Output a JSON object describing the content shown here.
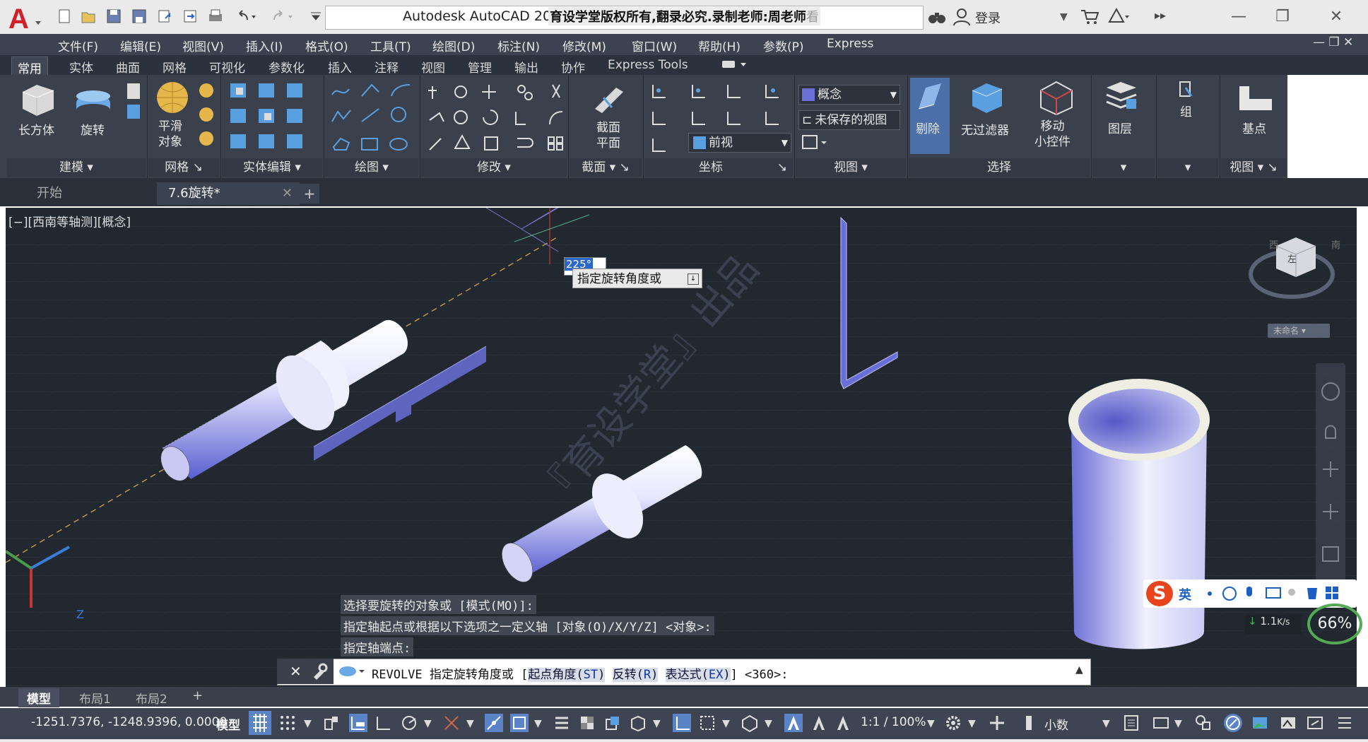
{
  "window": {
    "title": "Autodesk AutoCAD 201",
    "overlay_text": "育设学堂版权所有,翻录必究.录制老师:周老师",
    "overlay_suffix": "看",
    "login": "登录"
  },
  "menu": [
    "文件(F)",
    "编辑(E)",
    "视图(V)",
    "插入(I)",
    "格式(O)",
    "工具(T)",
    "绘图(D)",
    "标注(N)",
    "修改(M)",
    "窗口(W)",
    "帮助(H)",
    "参数(P)",
    "Express"
  ],
  "ribbon_tabs": [
    "常用",
    "实体",
    "曲面",
    "网格",
    "可视化",
    "参数化",
    "插入",
    "注释",
    "视图",
    "管理",
    "输出",
    "协作",
    "Express Tools"
  ],
  "ribbon": {
    "box": "长方体",
    "revolve": "旋转",
    "smooth_line1": "平滑",
    "smooth_line2": "对象",
    "section_line1": "截面",
    "section_line2": "平面",
    "visual_style": "概念",
    "saved_view": "未保存的视图",
    "front_view": "前视",
    "cull": "剔除",
    "no_filter": "无过滤器",
    "gizmo_line1": "移动",
    "gizmo_line2": "小控件",
    "layers": "图层",
    "group": "组",
    "base_point": "基点",
    "panels": [
      "建模",
      "网格",
      "实体编辑",
      "绘图",
      "修改",
      "截面",
      "坐标",
      "视图",
      "选择",
      "视图"
    ]
  },
  "doc_tabs": [
    "开始",
    "7.6旋转*"
  ],
  "viewport": {
    "label": "[−][西南等轴测][概念]",
    "tooltip": "指定旋转角度或",
    "angle_input": "225°",
    "viewcube_label": "未命名",
    "viewcube_face": "左",
    "compass_w": "西",
    "compass_s": "南",
    "ucs_z": "Z",
    "watermark": "『育设学堂』出品"
  },
  "command": {
    "history": [
      "选择要旋转的对象或 [模式(MO)]:",
      "指定轴起点或根据以下选项之一定义轴 [对象(O)/X/Y/Z] <对象>:",
      "指定轴端点:"
    ],
    "prompt_cmd": "REVOLVE 指定旋转角度或 [",
    "opt1_label": "起点角度(",
    "opt1_key": "ST",
    "opt2_label": "反转(",
    "opt2_key": "R",
    "opt3_label": "表达式(",
    "opt3_key": "EX",
    "prompt_end": "] <360>:"
  },
  "layout_tabs": [
    "模型",
    "布局1",
    "布局2"
  ],
  "status": {
    "coords": "-1251.7376, -1248.9396, 0.0000",
    "model": "模型",
    "scale": "1:1 / 100%",
    "units": "小数"
  },
  "ime": {
    "lang": "英",
    "speed": "1.1",
    "speed_unit": "K/s",
    "percent": "66%"
  },
  "colors": {
    "viewport_bg": "#212830",
    "ribbon_bg": "#3a404c",
    "accent": "#2b67c9",
    "solid_face": "#8f94e8"
  }
}
